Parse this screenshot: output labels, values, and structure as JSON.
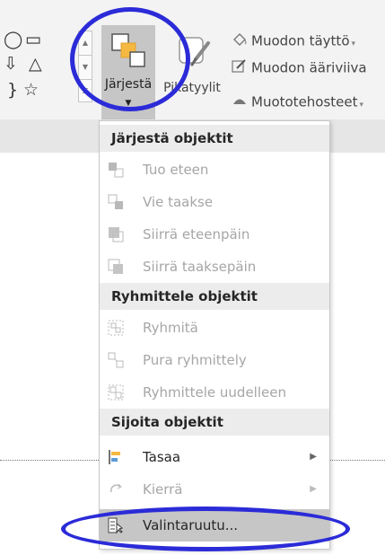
{
  "ribbon": {
    "arrange_label": "Järjestä",
    "quick_styles_label": "Pikatyylit",
    "shape_fill": "Muodon täyttö",
    "shape_outline": "Muodon ääriviiva",
    "shape_effects": "Muototehosteet",
    "gallery_shapes": [
      "◯",
      "▭",
      "⇩",
      "△",
      "}",
      "☆"
    ]
  },
  "menu": {
    "sections": [
      {
        "header": "Järjestä objektit",
        "items": [
          {
            "label": "Tuo eteen",
            "icon": "bring-forward-icon",
            "enabled": false,
            "submenu": false
          },
          {
            "label": "Vie taakse",
            "icon": "send-backward-icon",
            "enabled": false,
            "submenu": false
          },
          {
            "label": "Siirrä eteenpäin",
            "icon": "bring-to-front-icon",
            "enabled": false,
            "submenu": false
          },
          {
            "label": "Siirrä taaksepäin",
            "icon": "send-to-back-icon",
            "enabled": false,
            "submenu": false
          }
        ]
      },
      {
        "header": "Ryhmittele objektit",
        "items": [
          {
            "label": "Ryhmitä",
            "icon": "group-icon",
            "enabled": false,
            "submenu": false
          },
          {
            "label": "Pura ryhmittely",
            "icon": "ungroup-icon",
            "enabled": false,
            "submenu": false
          },
          {
            "label": "Ryhmittele uudelleen",
            "icon": "regroup-icon",
            "enabled": false,
            "submenu": false
          }
        ]
      },
      {
        "header": "Sijoita objektit",
        "items": [
          {
            "label": "Tasaa",
            "icon": "align-icon",
            "enabled": true,
            "submenu": true
          },
          {
            "label": "Kierrä",
            "icon": "rotate-icon",
            "enabled": false,
            "submenu": true
          },
          {
            "label": "Valintaruutu...",
            "icon": "selection-pane-icon",
            "enabled": true,
            "submenu": false,
            "highlighted": true
          }
        ]
      }
    ]
  },
  "colors": {
    "annotation": "#2b2bd8",
    "highlight": "#c6c6c6",
    "accent_orange": "#f5b942"
  }
}
